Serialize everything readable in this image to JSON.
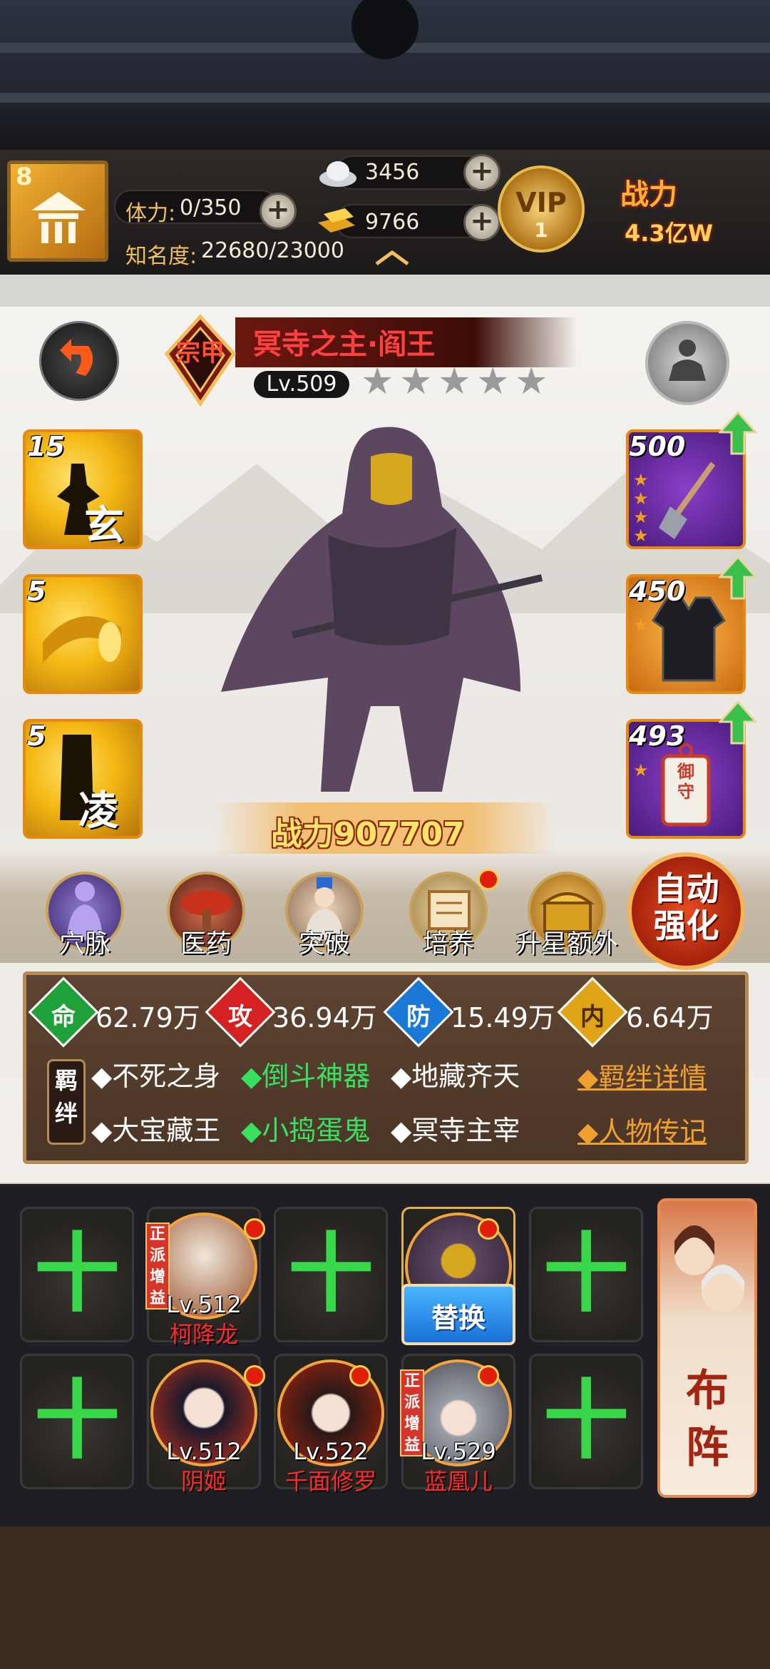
{
  "header": {
    "player_level": "8",
    "stamina_label": "体力:",
    "stamina_value": "0/350",
    "fame_label": "知名度:",
    "fame_value": "22680/23000",
    "silver": "3456",
    "gold": "9766",
    "plus": "+",
    "vip_label": "VIP",
    "vip_level": "1",
    "power_label": "战力",
    "power_value": "4.3亿W"
  },
  "hero": {
    "rank": "宗甲",
    "name": "冥寺之主·阎王",
    "level": "Lv.509",
    "stars": 5,
    "star_glyph": "★",
    "power_label": "战力",
    "power_value": "907707"
  },
  "skills": [
    {
      "level": "15",
      "char": "玄"
    },
    {
      "level": "5",
      "char": ""
    },
    {
      "level": "5",
      "char": "凌"
    }
  ],
  "equipment": [
    {
      "level": "500",
      "stars": 4,
      "item": "shovel-icon"
    },
    {
      "level": "450",
      "stars": 1,
      "item": "vest-icon"
    },
    {
      "level": "493",
      "stars": 1,
      "item": "charm-icon",
      "charm_text": "御守"
    }
  ],
  "features": [
    {
      "label": "穴脉",
      "badge": false
    },
    {
      "label": "医药",
      "badge": false
    },
    {
      "label": "突破",
      "badge": false
    },
    {
      "label": "培养",
      "badge": true
    },
    {
      "label": "升星额外",
      "badge": false
    }
  ],
  "auto_enhance": "自动强化",
  "auto_enhance_line1": "自动",
  "auto_enhance_line2": "强化",
  "stats": [
    {
      "char": "命",
      "value": "62.79万",
      "color": "#1fa13a"
    },
    {
      "char": "攻",
      "value": "36.94万",
      "color": "#d42222"
    },
    {
      "char": "防",
      "value": "15.49万",
      "color": "#1a78d6"
    },
    {
      "char": "内",
      "value": "6.64万",
      "color": "#e0a418"
    }
  ],
  "bonds": {
    "label": "羁绊",
    "row1": [
      {
        "text": "◆不死之身",
        "active": false
      },
      {
        "text": "◆倒斗神器",
        "active": true
      },
      {
        "text": "◆地藏齐天",
        "active": false
      }
    ],
    "row2": [
      {
        "text": "◆大宝藏王",
        "active": false
      },
      {
        "text": "◆小捣蛋鬼",
        "active": true
      },
      {
        "text": "◆冥寺主宰",
        "active": false
      }
    ],
    "detail_link": "◆羁绊详情",
    "bio_link": "◆人物传记"
  },
  "formation": {
    "replace_label": "替换",
    "buff_tag": "正派增益",
    "plus": "十",
    "button_label": "布阵",
    "row1": [
      {
        "empty": true
      },
      {
        "empty": false,
        "level": "Lv.512",
        "name": "柯降龙",
        "buff": true
      },
      {
        "empty": true
      },
      {
        "empty": false,
        "level": "",
        "name": "",
        "current": true
      },
      {
        "empty": true
      }
    ],
    "row2": [
      {
        "empty": true
      },
      {
        "empty": false,
        "level": "Lv.512",
        "name": "阴姬"
      },
      {
        "empty": false,
        "level": "Lv.522",
        "name": "千面修罗"
      },
      {
        "empty": false,
        "level": "Lv.529",
        "name": "蓝凰儿",
        "buff": true
      },
      {
        "empty": true
      }
    ]
  }
}
